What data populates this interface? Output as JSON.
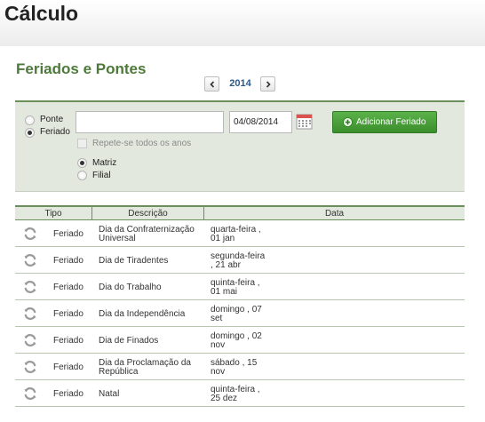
{
  "page": {
    "title": "Cálculo"
  },
  "section": {
    "title": "Feriados e Pontes"
  },
  "year_nav": {
    "prev_label": "<",
    "year": "2014",
    "next_label": ">"
  },
  "form": {
    "type_options": [
      {
        "label": "Ponte",
        "selected": false
      },
      {
        "label": "Feriado",
        "selected": true
      }
    ],
    "description": {
      "value": "",
      "placeholder": ""
    },
    "date": {
      "value": "04/08/2014"
    },
    "add_button": {
      "label": "Adicionar Feriado"
    },
    "repeat_checkbox": {
      "label": "Repete-se todos os anos",
      "checked": false,
      "disabled": true
    },
    "scope_options": [
      {
        "label": "Matriz",
        "selected": true
      },
      {
        "label": "Filial",
        "selected": false
      }
    ]
  },
  "table": {
    "columns": [
      "Tipo",
      "Descrição",
      "Data"
    ],
    "rows": [
      {
        "tipo": "Feriado",
        "descricao": "Dia da Confraternização Universal",
        "data": "quarta-feira , 01 jan"
      },
      {
        "tipo": "Feriado",
        "descricao": "Dia de Tiradentes",
        "data": "segunda-feira , 21 abr"
      },
      {
        "tipo": "Feriado",
        "descricao": "Dia do Trabalho",
        "data": "quinta-feira , 01 mai"
      },
      {
        "tipo": "Feriado",
        "descricao": "Dia da Independência",
        "data": "domingo , 07 set"
      },
      {
        "tipo": "Feriado",
        "descricao": "Dia de Finados",
        "data": "domingo , 02 nov"
      },
      {
        "tipo": "Feriado",
        "descricao": "Dia da Proclamação da República",
        "data": "sábado , 15 nov"
      },
      {
        "tipo": "Feriado",
        "descricao": "Natal",
        "data": "quinta-feira , 25 dez"
      }
    ]
  },
  "colors": {
    "accent_green": "#4d7a3a",
    "panel_bg": "#e2e8de",
    "button_green": "#3a8e2c",
    "year_blue": "#2b5a8a"
  },
  "icons": {
    "row_icon": "refresh-icon",
    "calendar": "calendar-icon",
    "add": "plus-icon"
  }
}
